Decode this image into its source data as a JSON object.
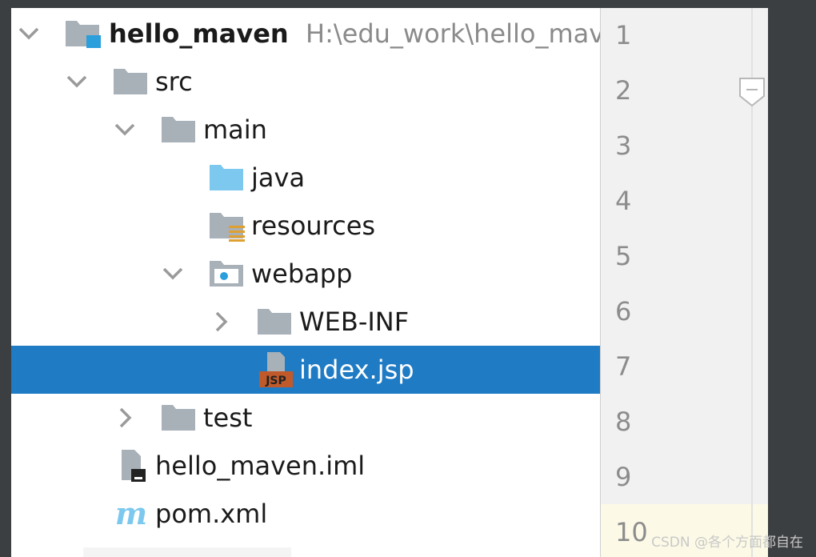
{
  "tree": {
    "items": [
      {
        "name": "hello_maven",
        "path": "H:\\edu_work\\hello_maven",
        "expanded": true,
        "icon": "module-folder-icon"
      },
      {
        "name": "src",
        "expanded": true,
        "icon": "folder-icon"
      },
      {
        "name": "main",
        "expanded": true,
        "icon": "folder-icon"
      },
      {
        "name": "java",
        "icon": "source-root-folder-icon"
      },
      {
        "name": "resources",
        "icon": "resources-folder-icon"
      },
      {
        "name": "webapp",
        "expanded": true,
        "icon": "web-folder-icon"
      },
      {
        "name": "WEB-INF",
        "expanded": false,
        "icon": "folder-icon"
      },
      {
        "name": "index.jsp",
        "selected": true,
        "icon": "jsp-file-icon"
      },
      {
        "name": "test",
        "expanded": false,
        "icon": "folder-icon"
      },
      {
        "name": "hello_maven.iml",
        "icon": "iml-file-icon"
      },
      {
        "name": "pom.xml",
        "icon": "maven-file-icon"
      }
    ]
  },
  "gutter": {
    "line_numbers": [
      "1",
      "2",
      "3",
      "4",
      "5",
      "6",
      "7",
      "8",
      "9",
      "10"
    ]
  },
  "watermark": "CSDN @各个方面都自在",
  "colors": {
    "selection": "#1f7bc4",
    "tree_background": "#ffffff",
    "gutter_background": "#f1f1f1",
    "ide_dark": "#3c3f41",
    "folder_gray": "#a8b0b8",
    "source_blue": "#7cc8ee"
  }
}
